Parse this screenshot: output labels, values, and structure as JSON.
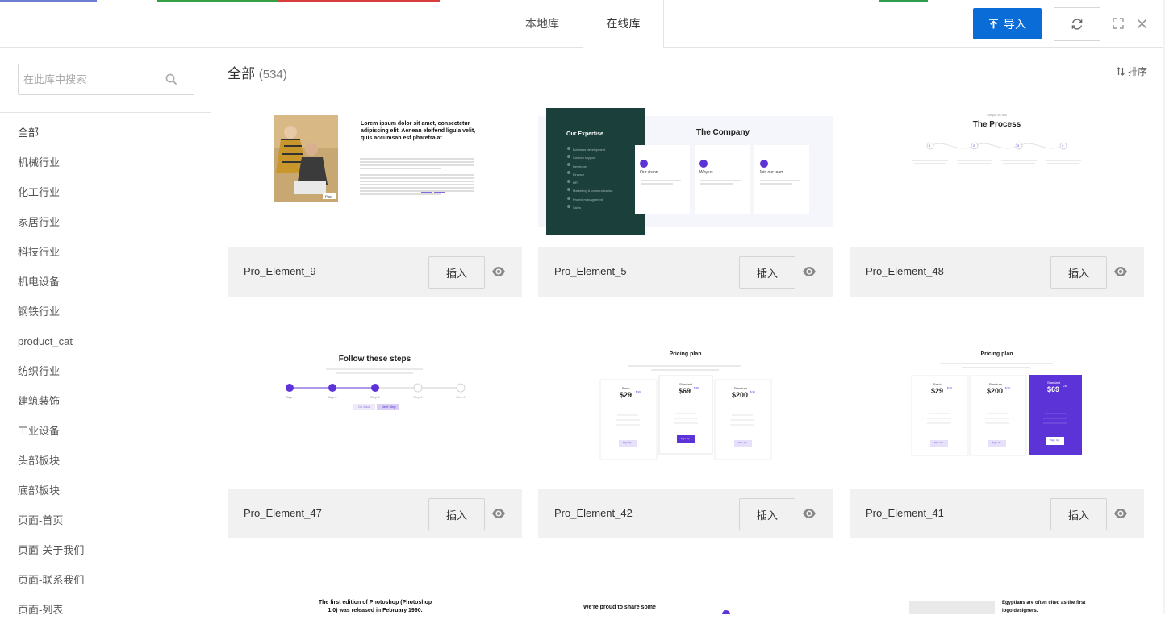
{
  "header": {
    "tabs": [
      {
        "label": "本地库"
      },
      {
        "label": "在线库"
      }
    ],
    "active_tab": 1,
    "import_label": "导入"
  },
  "sidebar": {
    "search_placeholder": "在此库中搜索",
    "categories": [
      "全部",
      "机械行业",
      "化工行业",
      "家居行业",
      "科技行业",
      "机电设备",
      "钢铁行业",
      "product_cat",
      "纺织行业",
      "建筑装饰",
      "工业设备",
      "头部板块",
      "底部板块",
      "页面-首页",
      "页面-关于我们",
      "页面-联系我们",
      "页面-列表"
    ]
  },
  "main": {
    "title": "全部",
    "count": "(534)",
    "sort_label": "排序",
    "insert_label": "插入",
    "cards": [
      {
        "name": "Pro_Element_9",
        "preview": {
          "headline": "Lorem ipsum dolor sit amet, consectetur adipiscing elit. Aenean eleifend ligula velit, quis accumsan est pharetra at.",
          "button": "Play"
        }
      },
      {
        "name": "Pro_Element_5",
        "preview": {
          "left_title": "Our Expertise",
          "items": [
            "Business development",
            "Custom support",
            "Developer",
            "Finance",
            "HR",
            "Marketing & communication",
            "Project management",
            "Sales"
          ],
          "right_title": "The Company",
          "columns": [
            "Our vision",
            "Why us",
            "Join our team"
          ]
        }
      },
      {
        "name": "Pro_Element_48",
        "preview": {
          "kicker": "Simple as this",
          "title": "The Process",
          "steps": [
            "1",
            "2",
            "3",
            "4"
          ]
        }
      },
      {
        "name": "Pro_Element_47",
        "preview": {
          "title": "Follow these steps",
          "steps": [
            "Step 1",
            "Step 2",
            "Step 3",
            "Step 4",
            "Step 5"
          ],
          "buttons": [
            "Go Back",
            "Next Step"
          ]
        }
      },
      {
        "name": "Pro_Element_42",
        "preview": {
          "title": "Pricing plan",
          "plans": [
            {
              "name": "Basic",
              "price": "$29",
              "cents": "$.99",
              "cta": "Sign Up"
            },
            {
              "name": "Standard",
              "price": "$69",
              "cents": "$.99",
              "cta": "Sign Up"
            },
            {
              "name": "Premium",
              "price": "$200",
              "cents": "$.99",
              "cta": "Sign Up"
            }
          ]
        }
      },
      {
        "name": "Pro_Element_41",
        "preview": {
          "title": "Pricing plan",
          "plans": [
            {
              "name": "Basic",
              "price": "$29",
              "cents": "$.99",
              "cta": "Sign Up"
            },
            {
              "name": "Premium",
              "price": "$200",
              "cents": "$.99",
              "cta": "Sign Up"
            },
            {
              "name": "Standard",
              "price": "$69",
              "cents": "$.99",
              "cta": "Sign Up"
            }
          ]
        }
      }
    ],
    "partial_cards": [
      {
        "text": "The first edition of Photoshop (Photoshop 1.0) was released in February 1990."
      },
      {
        "text": "We're proud to share some"
      },
      {
        "text": "Egyptians are often cited as the first logo designers."
      }
    ]
  },
  "colors": {
    "accent": "#0a6cd6",
    "violet": "#5b33d6",
    "teal": "#1b3f3b"
  }
}
